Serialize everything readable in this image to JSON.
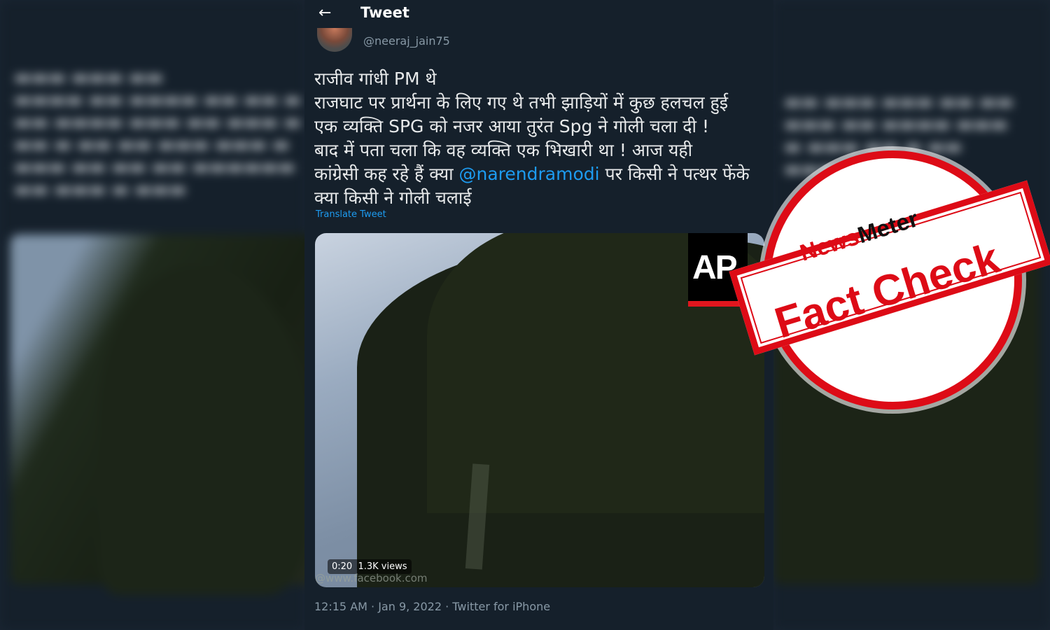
{
  "header": {
    "title": "Tweet",
    "back_icon": "arrow-left-icon"
  },
  "author": {
    "handle": "@neeraj_jain75"
  },
  "tweet": {
    "lines": [
      "राजीव गांधी PM थे",
      "राजघाट पर प्रार्थना के लिए गए थे तभी झाड़ियों में कुछ हलचल हुई",
      "एक व्यक्ति SPG को नजर आया तुरंत Spg ने गोली चला दी !",
      "बाद में पता चला कि वह व्यक्ति एक भिखारी था  ! आज यही"
    ],
    "line5_before": "कांग्रेसी कह रहे हैं क्या ",
    "mention": "@narendramodi",
    "line5_after": " पर किसी ने पत्थर फेंके",
    "line6": "क्या किसी ने गोली चलाई",
    "translate": "Translate Tweet"
  },
  "media": {
    "logo": "AP",
    "duration": "0:20",
    "views": "1.3K views",
    "watermark": "@www.facebook.com"
  },
  "footer": {
    "meta": "12:15 AM · Jan 9, 2022 · Twitter for iPhone"
  },
  "stamp": {
    "brand_a": "News",
    "brand_b": "Meter",
    "label": "Fact Check"
  },
  "colors": {
    "stamp_red": "#dd0b16",
    "link_blue": "#1d9bf0",
    "background": "#15202b"
  }
}
